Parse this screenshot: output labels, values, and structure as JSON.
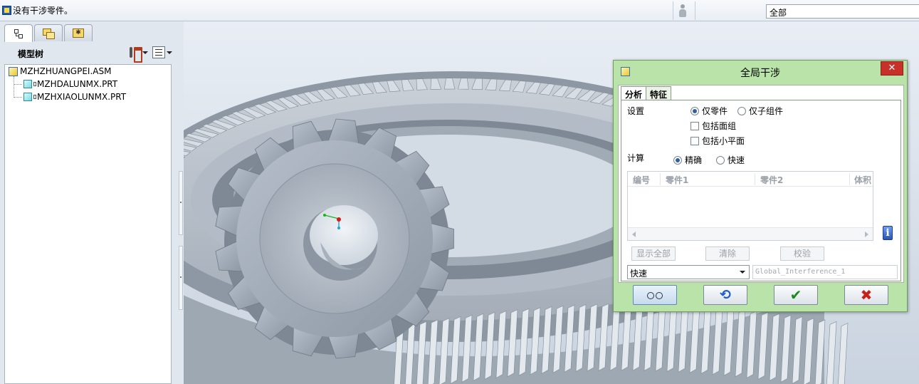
{
  "status_bar": {
    "message": "没有干涉零件。",
    "filter_value": "全部",
    "icons": [
      "status-info-icon",
      "person-icon"
    ]
  },
  "left_panel": {
    "tabs": [
      "model-tree-tab",
      "layers-tab",
      "favorites-tab"
    ],
    "title": "模型树",
    "tree": {
      "root": "MZHZHUANGPEI.ASM",
      "children": [
        "MZHDALUNMX.PRT",
        "MZHXIAOLUNMX.PRT"
      ]
    }
  },
  "dialog": {
    "title": "全局干涉",
    "close_label": "✕",
    "tabs": [
      "分析",
      "特征"
    ],
    "settings_label": "设置",
    "setting_options": [
      "仅零件",
      "仅子组件"
    ],
    "checkboxes": [
      "包括面组",
      "包括小平面"
    ],
    "compute_label": "计算",
    "compute_options": [
      "精确",
      "快速"
    ],
    "results_columns": [
      "编号",
      "零件1",
      "零件2",
      "体积"
    ],
    "info_label": "i",
    "buttons": {
      "show_all": "显示全部",
      "clear": "清除",
      "verify": "校验"
    },
    "mode_value": "快速",
    "name_value": "Global_Interference_1",
    "footer_icons": [
      "glasses-icon",
      "refresh-icon",
      "check-icon",
      "cancel-icon"
    ],
    "footer_glyphs": {
      "refresh": "⟲",
      "ok": "✔",
      "cancel": "✖"
    }
  }
}
